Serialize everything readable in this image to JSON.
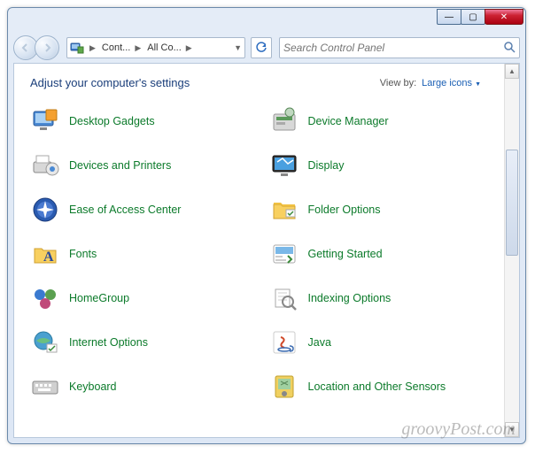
{
  "window": {
    "min_icon": "—",
    "max_icon": "▢",
    "close_icon": "✕"
  },
  "breadcrumb": {
    "seg1": "Cont...",
    "seg2": "All Co..."
  },
  "search": {
    "placeholder": "Search Control Panel"
  },
  "heading": "Adjust your computer's settings",
  "viewby": {
    "label": "View by:",
    "value": "Large icons"
  },
  "items": [
    {
      "label": "Desktop Gadgets",
      "icon": "gadgets"
    },
    {
      "label": "Device Manager",
      "icon": "device-mgr"
    },
    {
      "label": "Devices and Printers",
      "icon": "devices-printers"
    },
    {
      "label": "Display",
      "icon": "display"
    },
    {
      "label": "Ease of Access Center",
      "icon": "ease-access"
    },
    {
      "label": "Folder Options",
      "icon": "folder"
    },
    {
      "label": "Fonts",
      "icon": "fonts"
    },
    {
      "label": "Getting Started",
      "icon": "getting-started"
    },
    {
      "label": "HomeGroup",
      "icon": "homegroup"
    },
    {
      "label": "Indexing Options",
      "icon": "indexing"
    },
    {
      "label": "Internet Options",
      "icon": "internet"
    },
    {
      "label": "Java",
      "icon": "java"
    },
    {
      "label": "Keyboard",
      "icon": "keyboard"
    },
    {
      "label": "Location and Other Sensors",
      "icon": "location"
    }
  ],
  "watermark": "groovyPost.com"
}
